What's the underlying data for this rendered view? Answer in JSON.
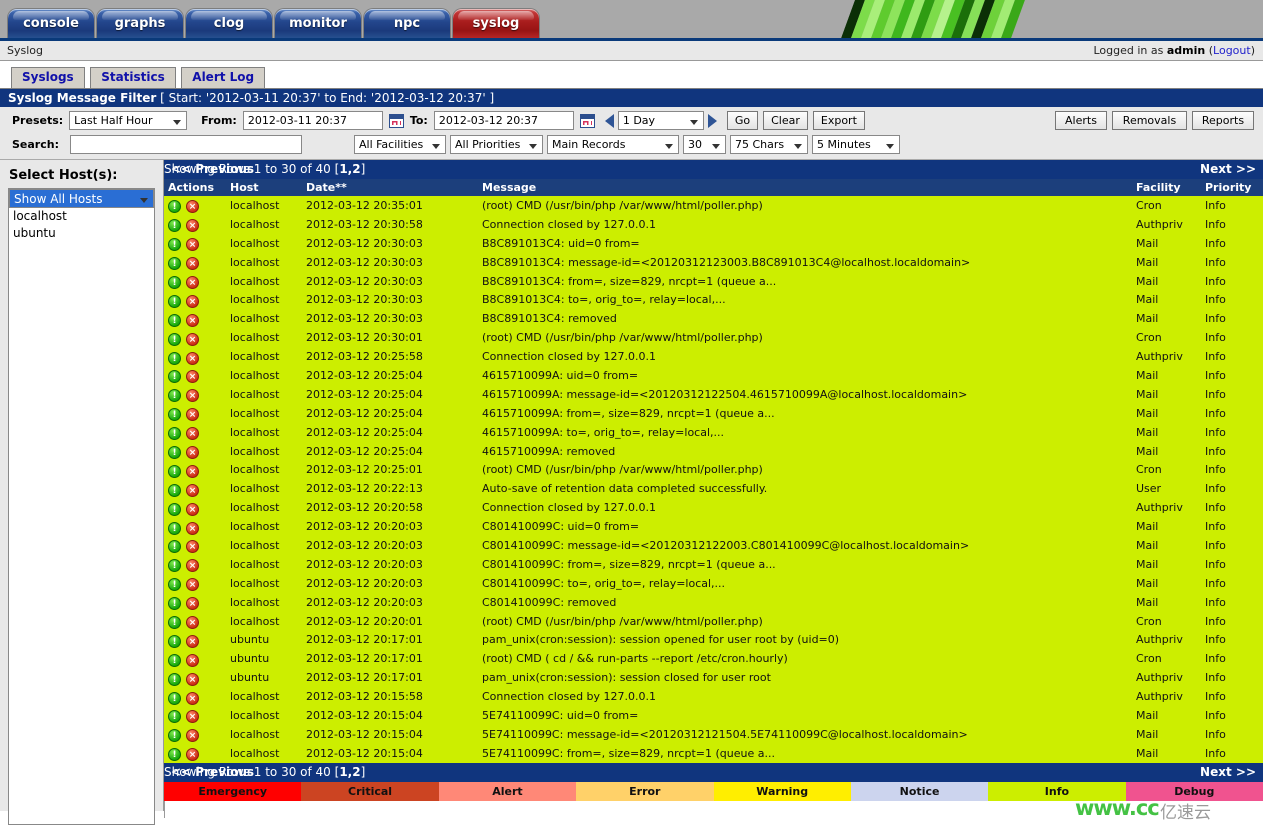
{
  "nav": {
    "tabs": [
      {
        "label": "console",
        "active": false
      },
      {
        "label": "graphs",
        "active": false
      },
      {
        "label": "clog",
        "active": false
      },
      {
        "label": "monitor",
        "active": false
      },
      {
        "label": "npc",
        "active": false
      },
      {
        "label": "syslog",
        "active": true
      }
    ]
  },
  "crumb": {
    "text": "Syslog"
  },
  "session": {
    "prefix": "Logged in as ",
    "user": "admin",
    "open": " (",
    "logout": "Logout",
    "close": ")"
  },
  "subtabs": [
    {
      "label": "Syslogs",
      "active": true
    },
    {
      "label": "Statistics",
      "active": false
    },
    {
      "label": "Alert Log",
      "active": false
    }
  ],
  "filter": {
    "title": "Syslog Message Filter",
    "range": "[ Start: '2012-03-11 20:37' to End: '2012-03-12 20:37' ]",
    "presets_label": "Presets:",
    "presets_value": "Last Half Hour",
    "from_label": "From:",
    "from_value": "2012-03-11 20:37",
    "to_label": "To:",
    "to_value": "2012-03-12 20:37",
    "step_value": "1 Day",
    "go_label": "Go",
    "clear_label": "Clear",
    "export_label": "Export",
    "alerts_label": "Alerts",
    "removals_label": "Removals",
    "reports_label": "Reports",
    "search_label": "Search:",
    "search_value": "",
    "search_placeholder": "",
    "facilities_value": "All Facilities",
    "priorities_value": "All Priorities",
    "records_value": "Main Records",
    "rows_value": "30",
    "chars_value": "75 Chars",
    "refresh_value": "5 Minutes"
  },
  "sidebar": {
    "title": "Select Host(s):",
    "hosts": [
      {
        "label": "Show All Hosts",
        "selected": true
      },
      {
        "label": "localhost",
        "selected": false
      },
      {
        "label": "ubuntu",
        "selected": false
      }
    ]
  },
  "pagination": {
    "previous": "<< Previous",
    "showing": "Showing Rows 1 to 30 of 40 [",
    "pages": "1,2",
    "showing_end": "]",
    "next": "Next >>"
  },
  "table": {
    "columns": [
      "Actions",
      "Host",
      "Date**",
      "Message",
      "Facility",
      "Priority"
    ],
    "action_icons": [
      "info-icon",
      "delete-icon"
    ],
    "rows": [
      {
        "host": "localhost",
        "date": "2012-03-12 20:35:01",
        "message": "(root) CMD (/usr/bin/php /var/www/html/poller.php)",
        "facility": "Cron",
        "priority": "Info"
      },
      {
        "host": "localhost",
        "date": "2012-03-12 20:30:58",
        "message": "Connection closed by 127.0.0.1",
        "facility": "Authpriv",
        "priority": "Info"
      },
      {
        "host": "localhost",
        "date": "2012-03-12 20:30:03",
        "message": "B8C891013C4: uid=0 from=",
        "facility": "Mail",
        "priority": "Info"
      },
      {
        "host": "localhost",
        "date": "2012-03-12 20:30:03",
        "message": "B8C891013C4: message-id=<20120312123003.B8C891013C4@localhost.localdomain>",
        "facility": "Mail",
        "priority": "Info"
      },
      {
        "host": "localhost",
        "date": "2012-03-12 20:30:03",
        "message": "B8C891013C4: from=, size=829, nrcpt=1 (queue a...",
        "facility": "Mail",
        "priority": "Info"
      },
      {
        "host": "localhost",
        "date": "2012-03-12 20:30:03",
        "message": "B8C891013C4: to=, orig_to=, relay=local,...",
        "facility": "Mail",
        "priority": "Info"
      },
      {
        "host": "localhost",
        "date": "2012-03-12 20:30:03",
        "message": "B8C891013C4: removed",
        "facility": "Mail",
        "priority": "Info"
      },
      {
        "host": "localhost",
        "date": "2012-03-12 20:30:01",
        "message": "(root) CMD (/usr/bin/php /var/www/html/poller.php)",
        "facility": "Cron",
        "priority": "Info"
      },
      {
        "host": "localhost",
        "date": "2012-03-12 20:25:58",
        "message": "Connection closed by 127.0.0.1",
        "facility": "Authpriv",
        "priority": "Info"
      },
      {
        "host": "localhost",
        "date": "2012-03-12 20:25:04",
        "message": "4615710099A: uid=0 from=",
        "facility": "Mail",
        "priority": "Info"
      },
      {
        "host": "localhost",
        "date": "2012-03-12 20:25:04",
        "message": "4615710099A: message-id=<20120312122504.4615710099A@localhost.localdomain>",
        "facility": "Mail",
        "priority": "Info"
      },
      {
        "host": "localhost",
        "date": "2012-03-12 20:25:04",
        "message": "4615710099A: from=, size=829, nrcpt=1 (queue a...",
        "facility": "Mail",
        "priority": "Info"
      },
      {
        "host": "localhost",
        "date": "2012-03-12 20:25:04",
        "message": "4615710099A: to=, orig_to=, relay=local,...",
        "facility": "Mail",
        "priority": "Info"
      },
      {
        "host": "localhost",
        "date": "2012-03-12 20:25:04",
        "message": "4615710099A: removed",
        "facility": "Mail",
        "priority": "Info"
      },
      {
        "host": "localhost",
        "date": "2012-03-12 20:25:01",
        "message": "(root) CMD (/usr/bin/php /var/www/html/poller.php)",
        "facility": "Cron",
        "priority": "Info"
      },
      {
        "host": "localhost",
        "date": "2012-03-12 20:22:13",
        "message": "Auto-save of retention data completed successfully.",
        "facility": "User",
        "priority": "Info"
      },
      {
        "host": "localhost",
        "date": "2012-03-12 20:20:58",
        "message": "Connection closed by 127.0.0.1",
        "facility": "Authpriv",
        "priority": "Info"
      },
      {
        "host": "localhost",
        "date": "2012-03-12 20:20:03",
        "message": "C801410099C: uid=0 from=",
        "facility": "Mail",
        "priority": "Info"
      },
      {
        "host": "localhost",
        "date": "2012-03-12 20:20:03",
        "message": "C801410099C: message-id=<20120312122003.C801410099C@localhost.localdomain>",
        "facility": "Mail",
        "priority": "Info"
      },
      {
        "host": "localhost",
        "date": "2012-03-12 20:20:03",
        "message": "C801410099C: from=, size=829, nrcpt=1 (queue a...",
        "facility": "Mail",
        "priority": "Info"
      },
      {
        "host": "localhost",
        "date": "2012-03-12 20:20:03",
        "message": "C801410099C: to=, orig_to=, relay=local,...",
        "facility": "Mail",
        "priority": "Info"
      },
      {
        "host": "localhost",
        "date": "2012-03-12 20:20:03",
        "message": "C801410099C: removed",
        "facility": "Mail",
        "priority": "Info"
      },
      {
        "host": "localhost",
        "date": "2012-03-12 20:20:01",
        "message": "(root) CMD (/usr/bin/php /var/www/html/poller.php)",
        "facility": "Cron",
        "priority": "Info"
      },
      {
        "host": "ubuntu",
        "date": "2012-03-12 20:17:01",
        "message": "pam_unix(cron:session): session opened for user root by (uid=0)",
        "facility": "Authpriv",
        "priority": "Info"
      },
      {
        "host": "ubuntu",
        "date": "2012-03-12 20:17:01",
        "message": "(root) CMD ( cd / && run-parts --report /etc/cron.hourly)",
        "facility": "Cron",
        "priority": "Info"
      },
      {
        "host": "ubuntu",
        "date": "2012-03-12 20:17:01",
        "message": "pam_unix(cron:session): session closed for user root",
        "facility": "Authpriv",
        "priority": "Info"
      },
      {
        "host": "localhost",
        "date": "2012-03-12 20:15:58",
        "message": "Connection closed by 127.0.0.1",
        "facility": "Authpriv",
        "priority": "Info"
      },
      {
        "host": "localhost",
        "date": "2012-03-12 20:15:04",
        "message": "5E74110099C: uid=0 from=",
        "facility": "Mail",
        "priority": "Info"
      },
      {
        "host": "localhost",
        "date": "2012-03-12 20:15:04",
        "message": "5E74110099C: message-id=<20120312121504.5E74110099C@localhost.localdomain>",
        "facility": "Mail",
        "priority": "Info"
      },
      {
        "host": "localhost",
        "date": "2012-03-12 20:15:04",
        "message": "5E74110099C: from=, size=829, nrcpt=1 (queue a...",
        "facility": "Mail",
        "priority": "Info"
      }
    ]
  },
  "legend": [
    {
      "label": "Emergency",
      "color": "#ff0000"
    },
    {
      "label": "Critical",
      "color": "#cc4422"
    },
    {
      "label": "Alert",
      "color": "#ff8877"
    },
    {
      "label": "Error",
      "color": "#ffd169"
    },
    {
      "label": "Warning",
      "color": "#ffee00"
    },
    {
      "label": "Notice",
      "color": "#ccd4ee"
    },
    {
      "label": "Info",
      "color": "#ccee00"
    },
    {
      "label": "Debug",
      "color": "#f0538f"
    }
  ],
  "watermark": {
    "text1": "www.cc",
    "text2": "亿速云"
  }
}
